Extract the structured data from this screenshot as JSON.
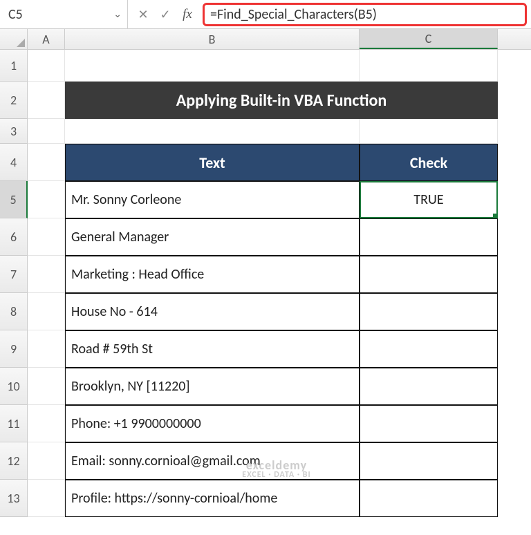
{
  "name_box": "C5",
  "formula": "=Find_Special_Characters(B5)",
  "columns": [
    "A",
    "B",
    "C"
  ],
  "row_heights": {
    "1": 46,
    "2": 54,
    "3": 36,
    "4": 54,
    "5": 54,
    "6": 54,
    "7": 54,
    "8": 54,
    "9": 54,
    "10": 54,
    "11": 54,
    "12": 54,
    "13": 54
  },
  "title": "Applying Built-in VBA Function",
  "headers": {
    "text": "Text",
    "check": "Check"
  },
  "rows": [
    {
      "text": "Mr. Sonny Corleone",
      "check": "TRUE"
    },
    {
      "text": "General Manager",
      "check": ""
    },
    {
      "text": "Marketing : Head Office",
      "check": ""
    },
    {
      "text": "House No - 614",
      "check": ""
    },
    {
      "text": "Road # 59th St",
      "check": ""
    },
    {
      "text": "Brooklyn, NY [11220]",
      "check": ""
    },
    {
      "text": "Phone: +1 9900000000",
      "check": ""
    },
    {
      "text": "Email: sonny.cornioal@gmail.com",
      "check": ""
    },
    {
      "text": "Profile: https://sonny-cornioal/home",
      "check": ""
    }
  ],
  "watermark": {
    "brand": "exceldemy",
    "sub": "EXCEL · DATA · BI"
  },
  "icons": {
    "dropdown": "⌄",
    "cancel": "✕",
    "enter": "✓",
    "fx": "fx"
  }
}
